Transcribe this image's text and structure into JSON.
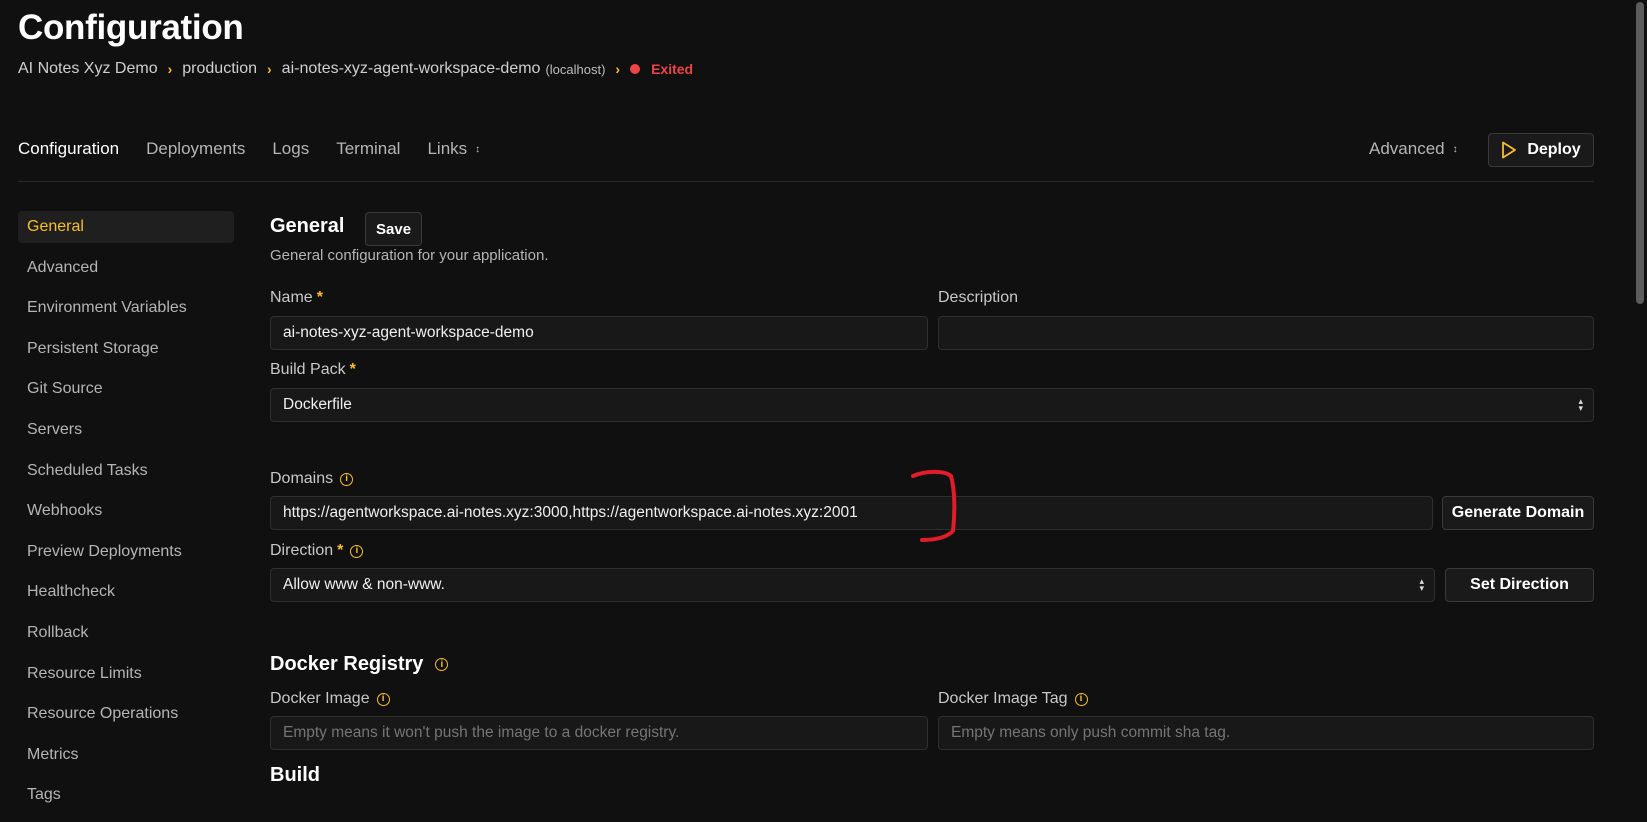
{
  "page": {
    "title": "Configuration"
  },
  "breadcrumb": {
    "project": "AI Notes Xyz Demo",
    "environment": "production",
    "resource": "ai-notes-xyz-agent-workspace-demo",
    "server": "(localhost)",
    "status": "Exited",
    "status_color": "#ef4444"
  },
  "tabs": {
    "configuration": "Configuration",
    "deployments": "Deployments",
    "logs": "Logs",
    "terminal": "Terminal",
    "links": "Links",
    "advanced": "Advanced",
    "deploy": "Deploy"
  },
  "sidebar": {
    "items": [
      {
        "label": "General",
        "active": true
      },
      {
        "label": "Advanced"
      },
      {
        "label": "Environment Variables"
      },
      {
        "label": "Persistent Storage"
      },
      {
        "label": "Git Source"
      },
      {
        "label": "Servers"
      },
      {
        "label": "Scheduled Tasks"
      },
      {
        "label": "Webhooks"
      },
      {
        "label": "Preview Deployments"
      },
      {
        "label": "Healthcheck"
      },
      {
        "label": "Rollback"
      },
      {
        "label": "Resource Limits"
      },
      {
        "label": "Resource Operations"
      },
      {
        "label": "Metrics"
      },
      {
        "label": "Tags"
      }
    ]
  },
  "general": {
    "title": "General",
    "save": "Save",
    "subtitle": "General configuration for your application.",
    "name_label": "Name",
    "name_value": "ai-notes-xyz-agent-workspace-demo",
    "description_label": "Description",
    "description_value": "",
    "buildpack_label": "Build Pack",
    "buildpack_value": "Dockerfile",
    "domains_label": "Domains",
    "domains_value": "https://agentworkspace.ai-notes.xyz:3000,https://agentworkspace.ai-notes.xyz:2001",
    "generate_domain": "Generate Domain",
    "direction_label": "Direction",
    "direction_value": "Allow www & non-www.",
    "set_direction": "Set Direction",
    "required_mark": "*"
  },
  "registry": {
    "title": "Docker Registry",
    "image_label": "Docker Image",
    "image_placeholder": "Empty means it won't push the image to a docker registry.",
    "tag_label": "Docker Image Tag",
    "tag_placeholder": "Empty means only push commit sha tag."
  },
  "build": {
    "title": "Build"
  },
  "colors": {
    "accent": "#fbbf24",
    "background": "#101010",
    "annotation": "#e11d2a"
  },
  "icons": {
    "info": "info-circle-icon",
    "chevron": "chevron-right-icon",
    "deploy": "play-icon",
    "select": "chevron-updown-icon"
  }
}
